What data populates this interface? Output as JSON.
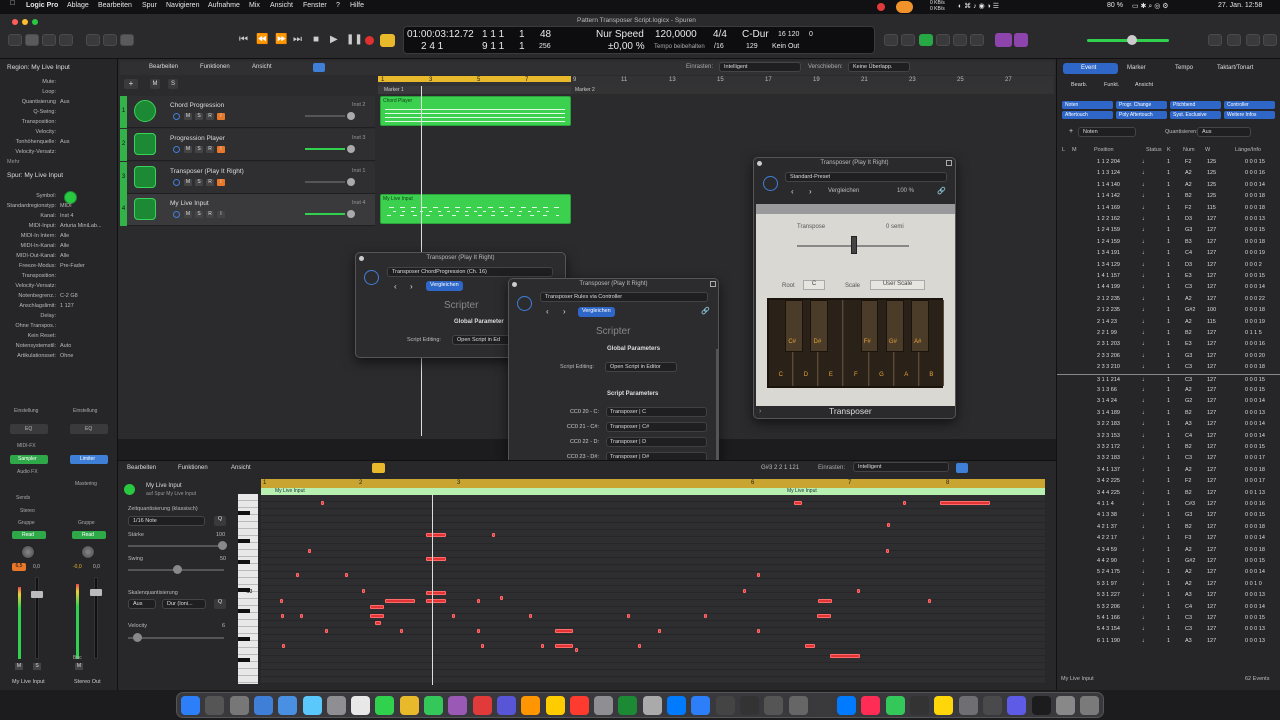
{
  "menubar": {
    "app": "Logic Pro",
    "items": [
      "Ablage",
      "Bearbeiten",
      "Spur",
      "Navigieren",
      "Aufnahme",
      "Mix",
      "Ansicht",
      "Fenster",
      "?",
      "Hilfe"
    ],
    "right_date": "27. Jan. 12:58",
    "net_up": "0 KB/s",
    "net_down": "0 KB/s",
    "battery": "80 %"
  },
  "window_title": "Pattern Transposer Script.logicx - Spuren",
  "lcd": {
    "time": "01:00:03:12.72",
    "bars_top": "1 1 1",
    "bars_top2": "1",
    "beats_top": "48",
    "bars_bot": "2 4 1",
    "bars_bot2": "9 1 1",
    "beat_bot2": "1",
    "div_bot": "256",
    "mode": "Nur Speed",
    "cents": "±0,00 %",
    "tempo": "120,0000",
    "tempo_label": "Tempo beibehalten",
    "sig": "4/4",
    "sig_div": "/16",
    "key": "C-Dur",
    "in": "129",
    "out": "Kein Out",
    "cpu_a": "16 120",
    "cpu_b": "16 120",
    "cpu_c": "0",
    "cpu_d": "0"
  },
  "inspector": {
    "region_header": "Region: My Live Input",
    "region_rows": [
      [
        "Mute:",
        ""
      ],
      [
        "Loop:",
        ""
      ],
      [
        "Quantisierung",
        "Aus"
      ],
      [
        "Q-Swing:",
        ""
      ],
      [
        "Transposition:",
        ""
      ],
      [
        "Velocity:",
        ""
      ],
      [
        "Tonhöhenquelle:",
        "Aus"
      ],
      [
        "Velocity-Versatz:",
        ""
      ]
    ],
    "more": "Mehr",
    "track_header": "Spur: My Live Input",
    "track_rows": [
      [
        "Symbol:",
        ""
      ],
      [
        "Standardregionstyp:",
        "MIDI"
      ],
      [
        "Kanal:",
        "Inst 4"
      ],
      [
        "MIDI-Input:",
        "Arturia MiniLab..."
      ],
      [
        "MIDI-In Intern:",
        "Alle"
      ],
      [
        "MIDI-In-Kanal:",
        "Alle"
      ],
      [
        "MIDI-Out-Kanal:",
        "Alle"
      ],
      [
        "Freeze-Modus:",
        "Pre-Fader"
      ],
      [
        "Transposition:",
        ""
      ],
      [
        "Velocity-Versatz:",
        ""
      ],
      [
        "Notenbegrenz.:",
        "C-2  G8"
      ],
      [
        "Anschlagslimit:",
        "1  127"
      ],
      [
        "Delay:",
        ""
      ],
      [
        "Ohne Transpos.:",
        ""
      ],
      [
        "Kein Reset:",
        ""
      ],
      [
        "Notensystemstil:",
        "Auto"
      ],
      [
        "Artikulationsset:",
        "Ohne"
      ]
    ],
    "strip1": {
      "setting": "Einstellung",
      "eq": "EQ",
      "midifx": "MIDI-FX",
      "instrument": "Sampler",
      "audiofx": "Audio FX",
      "sends": "Sends",
      "stereo": "Stereo",
      "gruppe": "Gruppe",
      "read": "Read",
      "vol": "6,5",
      "pan": "0,0",
      "m": "M",
      "s": "S",
      "name": "My Live Input"
    },
    "strip2": {
      "setting": "Einstellung",
      "eq": "EQ",
      "limiter": "Limiter",
      "mastering": "Mastering",
      "gruppe": "Gruppe",
      "read": "Read",
      "vol": "-0,0",
      "pan": "0,0",
      "bnc": "Bnc",
      "m": "M",
      "name": "Stereo Out"
    }
  },
  "tracks_bar": {
    "menus": [
      "Bearbeiten",
      "Funktionen",
      "Ansicht"
    ],
    "snap_label": "Einrasten:",
    "snap_value": "Intelligent",
    "move_label": "Verschieben:",
    "move_value": "Keine Überlapp."
  },
  "ruler": [
    "1",
    "3",
    "5",
    "7",
    "9",
    "11",
    "13",
    "15",
    "17",
    "19",
    "21",
    "23",
    "25",
    "27"
  ],
  "markers": [
    "Marker 1",
    "Marker 2"
  ],
  "tracks": [
    {
      "num": "1",
      "name": "Chord Progression",
      "inst": "Inst 2",
      "btns": [
        "M",
        "S",
        "R",
        "I"
      ]
    },
    {
      "num": "2",
      "name": "Progression Player",
      "inst": "Inst 3",
      "btns": [
        "M",
        "S",
        "R",
        "I"
      ]
    },
    {
      "num": "3",
      "name": "Transposer (Play It Right)",
      "inst": "Inst 1",
      "btns": [
        "M",
        "S",
        "R",
        "I"
      ]
    },
    {
      "num": "4",
      "name": "My Live Input",
      "inst": "Inst 4",
      "btns": [
        "M",
        "S",
        "R",
        "I"
      ]
    }
  ],
  "regions": [
    {
      "name": "Chord Player"
    },
    {
      "name": "My Live Input"
    }
  ],
  "scripter1": {
    "title": "Transposer (Play It Right)",
    "preset": "Transposer ChordProgression (Ch. 16)",
    "compare": "Vergleichen",
    "name": "Scripter",
    "global": "Global Parameter",
    "edit_label": "Script Editing:",
    "edit_btn": "Open Script in Ed"
  },
  "scripter2": {
    "title": "Transposer (Play It Right)",
    "preset": "Transposer Rules via Controller",
    "compare": "Vergleichen",
    "name": "Scripter",
    "global": "Global Parameters",
    "edit_label": "Script Editing:",
    "edit_btn": "Open Script in Editor",
    "params_head": "Script Parameters",
    "rows": [
      [
        "CC0 20 - C:",
        "Transposer | C"
      ],
      [
        "CC0 21 - C#:",
        "Transposer | C#"
      ],
      [
        "CC0 22 - D:",
        "Transposer | D"
      ],
      [
        "CC0 23 - D#:",
        "Transposer | D#"
      ],
      [
        "CC0 24 - E:",
        "Transposer | E"
      ],
      [
        "CC0 25 - F:",
        "Transposer | F"
      ],
      [
        "CC0 26 - F#:",
        "Transposer | F#"
      ],
      [
        "CC0 27 - G:",
        "Transposer | G"
      ],
      [
        "CC0 28 - G#:",
        "Transposer | G#"
      ],
      [
        "CC0 29 - A:",
        "Transposer | A"
      ],
      [
        "CC0 30 - A#:",
        "Transposer | A#"
      ],
      [
        "CC0 31 - B:",
        "Transposer | B"
      ]
    ]
  },
  "transposer": {
    "title": "Transposer (Play It Right)",
    "preset": "Standard-Preset",
    "compare": "Vergleichen",
    "zoom": "100 %",
    "transpose_label": "Transpose",
    "transpose_val": "0 semi",
    "root_label": "Root",
    "root_val": "C",
    "scale_label": "Scale",
    "scale_val": "User Scale",
    "black_keys": [
      "C#",
      "D#",
      "F#",
      "G#",
      "A#"
    ],
    "white_keys": [
      "C",
      "D",
      "E",
      "F",
      "G",
      "A",
      "B"
    ],
    "footer": "Transposer"
  },
  "pianoroll": {
    "menus": [
      "Bearbeiten",
      "Funktionen",
      "Ansicht"
    ],
    "pos": "G#3  2 2 1 121",
    "snap_label": "Einrasten:",
    "snap_value": "Intelligent",
    "region_name": "My Live Input",
    "region_sub": "auf Spur My Live Input",
    "quant_label": "Zeitquantisierung (klassisch)",
    "quant_val": "1/16 Note",
    "strength_label": "Stärke",
    "strength_val": "100",
    "swing_label": "Swing",
    "swing_val": "50",
    "scale_label": "Skalenquantisierung",
    "scale_a": "Aus",
    "scale_b": "Dur (Ioni...",
    "vel_label": "Velocity",
    "vel_val": "6",
    "ruler": [
      "1",
      "2",
      "3",
      "6",
      "7",
      "8"
    ],
    "c3": "C3",
    "region_strip": "My Live Input"
  },
  "eventlist": {
    "tabs": [
      "Event",
      "Marker",
      "Tempo",
      "Taktart/Tonart"
    ],
    "sub": [
      "Bearb.",
      "Funkt.",
      "Ansicht"
    ],
    "filters": [
      "Noten",
      "Progr. Change",
      "Pitchbend",
      "Controller",
      "Aftertouch",
      "Poly Aftertouch",
      "Syst. Exclusive",
      "Weitere Infos"
    ],
    "add_label": "Noten",
    "quant_label": "Quantisieren:",
    "quant_val": "Aus",
    "cols": [
      "L",
      "M",
      "Position",
      "Status",
      "K",
      "Num",
      "W",
      "Länge/Info"
    ],
    "footer_left": "My Live Input",
    "footer_right": "62 Events",
    "rows": [
      [
        "1 1 2 204",
        "1",
        "F2",
        "125",
        "0 0 0 15"
      ],
      [
        "1 1 3 124",
        "1",
        "A2",
        "125",
        "0 0 0 16"
      ],
      [
        "1 1 4 140",
        "1",
        "A2",
        "125",
        "0 0 0 14"
      ],
      [
        "1 1 4 142",
        "1",
        "B2",
        "125",
        "0 0 0 18"
      ],
      [
        "1 1 4 169",
        "1",
        "F2",
        "115",
        "0 0 0 18"
      ],
      [
        "1 2 2 162",
        "1",
        "D3",
        "127",
        "0 0 0 13"
      ],
      [
        "1 2 4 159",
        "1",
        "G3",
        "127",
        "0 0 0 15"
      ],
      [
        "1 2 4 159",
        "1",
        "B3",
        "127",
        "0 0 0 18"
      ],
      [
        "1 3 4 191",
        "1",
        "C4",
        "127",
        "0 0 0 19"
      ],
      [
        "1 3 4 129",
        "1",
        "D3",
        "127",
        "0 0 0 2"
      ],
      [
        "1 4 1 157",
        "1",
        "E3",
        "127",
        "0 0 0 15"
      ],
      [
        "1 4 4 199",
        "1",
        "C3",
        "127",
        "0 0 0 14"
      ],
      [
        "2 1 2 235",
        "1",
        "A2",
        "127",
        "0 0 0 22"
      ],
      [
        "2 1 2 235",
        "1",
        "G#2",
        "100",
        "0 0 0 18"
      ],
      [
        "2 1 4 23",
        "1",
        "A2",
        "115",
        "0 0 0 19"
      ],
      [
        "2 2 1 99",
        "1",
        "B2",
        "127",
        "0 1 1 5"
      ],
      [
        "2 3 1 203",
        "1",
        "E3",
        "127",
        "0 0 0 16"
      ],
      [
        "2 3 3 206",
        "1",
        "G3",
        "127",
        "0 0 0 20"
      ],
      [
        "2 3 3 210",
        "1",
        "C3",
        "127",
        "0 0 0 18"
      ],
      [
        "3 1 1 214",
        "1",
        "C3",
        "127",
        "0 0 0 15"
      ],
      [
        "3 1 3 66",
        "1",
        "A2",
        "127",
        "0 0 0 15"
      ],
      [
        "3 1 4 24",
        "1",
        "G2",
        "127",
        "0 0 0 14"
      ],
      [
        "3 1 4 189",
        "1",
        "B2",
        "127",
        "0 0 0 13"
      ],
      [
        "3 2 2 183",
        "1",
        "A3",
        "127",
        "0 0 0 14"
      ],
      [
        "3 2 3 153",
        "1",
        "C4",
        "127",
        "0 0 0 14"
      ],
      [
        "3 3 2 172",
        "1",
        "B2",
        "127",
        "0 0 0 15"
      ],
      [
        "3 3 2 183",
        "1",
        "C3",
        "127",
        "0 0 0 17"
      ],
      [
        "3 4 1 137",
        "1",
        "A2",
        "127",
        "0 0 0 18"
      ],
      [
        "3 4 2 225",
        "1",
        "F2",
        "127",
        "0 0 0 17"
      ],
      [
        "3 4 4 225",
        "1",
        "B2",
        "127",
        "0 0 1 13"
      ],
      [
        "4 1 1 4",
        "1",
        "C#3",
        "127",
        "0 0 0 16"
      ],
      [
        "4 1 3 38",
        "1",
        "G3",
        "127",
        "0 0 0 15"
      ],
      [
        "4 2 1 37",
        "1",
        "B2",
        "127",
        "0 0 0 18"
      ],
      [
        "4 2 2 17",
        "1",
        "F3",
        "127",
        "0 0 0 14"
      ],
      [
        "4 3 4 59",
        "1",
        "A2",
        "127",
        "0 0 0 18"
      ],
      [
        "4 4 2 90",
        "1",
        "G#2",
        "127",
        "0 0 0 15"
      ],
      [
        "5 2 4 175",
        "1",
        "A2",
        "127",
        "0 0 0 14"
      ],
      [
        "5 3 1 97",
        "1",
        "A2",
        "127",
        "0 0 1 0"
      ],
      [
        "5 3 1 227",
        "1",
        "A3",
        "127",
        "0 0 0 13"
      ],
      [
        "5 3 2 206",
        "1",
        "C4",
        "127",
        "0 0 0 14"
      ],
      [
        "5 4 1 166",
        "1",
        "C3",
        "127",
        "0 0 0 15"
      ],
      [
        "5 4 3 154",
        "1",
        "C3",
        "127",
        "0 0 0 13"
      ],
      [
        "6 1 1 190",
        "1",
        "A3",
        "127",
        "0 0 0 13"
      ]
    ]
  },
  "dock_count": "38"
}
